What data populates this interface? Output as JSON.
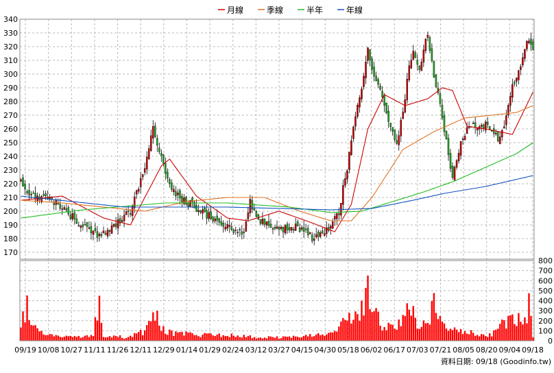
{
  "legend": [
    {
      "label": "月線",
      "color": "#cc0000"
    },
    {
      "label": "季線",
      "color": "#e07020"
    },
    {
      "label": "半年",
      "color": "#22bb22"
    },
    {
      "label": "年線",
      "color": "#1050c0"
    }
  ],
  "footer": {
    "text": "資料日期: 09/18 (Goodinfo.tw)"
  },
  "colors": {
    "up": "#d00000",
    "down": "#22aa22",
    "volume": "#ff0000",
    "grid": "#b8b8b8"
  },
  "chart_data": [
    {
      "type": "candlestick",
      "ylim": [
        165,
        340
      ],
      "yticks": [
        170,
        180,
        190,
        200,
        210,
        220,
        230,
        240,
        250,
        260,
        270,
        280,
        290,
        300,
        310,
        320,
        330,
        340
      ],
      "x_tick_labels": [
        "09/19",
        "10/08",
        "10/27",
        "11/11",
        "11/26",
        "12/11",
        "12/29",
        "01/14",
        "01/29",
        "02/24",
        "03/12",
        "03/27",
        "04/15",
        "04/30",
        "05/18",
        "06/02",
        "06/17",
        "07/03",
        "07/21",
        "08/05",
        "08/20",
        "09/04",
        "09/18"
      ],
      "close_knots": [
        [
          0,
          222
        ],
        [
          3,
          214
        ],
        [
          8,
          211
        ],
        [
          13,
          209
        ],
        [
          18,
          205
        ],
        [
          23,
          199
        ],
        [
          28,
          190
        ],
        [
          33,
          186
        ],
        [
          38,
          181
        ],
        [
          43,
          186
        ],
        [
          48,
          193
        ],
        [
          53,
          200
        ],
        [
          57,
          218
        ],
        [
          61,
          238
        ],
        [
          64,
          263
        ],
        [
          67,
          244
        ],
        [
          71,
          224
        ],
        [
          75,
          212
        ],
        [
          80,
          207
        ],
        [
          86,
          201
        ],
        [
          92,
          196
        ],
        [
          98,
          190
        ],
        [
          103,
          186
        ],
        [
          108,
          184
        ],
        [
          111,
          208
        ],
        [
          114,
          196
        ],
        [
          120,
          189
        ],
        [
          126,
          187
        ],
        [
          132,
          189
        ],
        [
          138,
          185
        ],
        [
          142,
          179
        ],
        [
          146,
          184
        ],
        [
          150,
          188
        ],
        [
          154,
          200
        ],
        [
          158,
          232
        ],
        [
          162,
          268
        ],
        [
          165,
          290
        ],
        [
          168,
          318
        ],
        [
          171,
          300
        ],
        [
          174,
          288
        ],
        [
          178,
          265
        ],
        [
          182,
          248
        ],
        [
          185,
          272
        ],
        [
          188,
          305
        ],
        [
          190,
          315
        ],
        [
          193,
          305
        ],
        [
          197,
          330
        ],
        [
          200,
          300
        ],
        [
          203,
          278
        ],
        [
          206,
          250
        ],
        [
          209,
          226
        ],
        [
          213,
          250
        ],
        [
          217,
          264
        ],
        [
          221,
          262
        ],
        [
          225,
          263
        ],
        [
          229,
          258
        ],
        [
          232,
          252
        ],
        [
          235,
          270
        ],
        [
          238,
          290
        ],
        [
          241,
          300
        ],
        [
          244,
          316
        ],
        [
          246,
          326
        ],
        [
          248,
          318
        ]
      ],
      "lines": [
        {
          "name": "月線",
          "knots": [
            [
              0,
              208
            ],
            [
              20,
              211
            ],
            [
              40,
              195
            ],
            [
              53,
              190
            ],
            [
              68,
              233
            ],
            [
              72,
              238
            ],
            [
              85,
              211
            ],
            [
              100,
              195
            ],
            [
              110,
              193
            ],
            [
              125,
              200
            ],
            [
              140,
              192
            ],
            [
              152,
              185
            ],
            [
              160,
              205
            ],
            [
              168,
              260
            ],
            [
              176,
              285
            ],
            [
              186,
              277
            ],
            [
              197,
              282
            ],
            [
              204,
              290
            ],
            [
              209,
              288
            ],
            [
              216,
              262
            ],
            [
              225,
              260
            ],
            [
              238,
              256
            ],
            [
              248,
              287
            ]
          ]
        },
        {
          "name": "季線",
          "knots": [
            [
              0,
              208
            ],
            [
              20,
              206
            ],
            [
              40,
              203
            ],
            [
              60,
              200
            ],
            [
              80,
              207
            ],
            [
              100,
              210
            ],
            [
              118,
              210
            ],
            [
              135,
              200
            ],
            [
              150,
              193
            ],
            [
              160,
              193
            ],
            [
              170,
              210
            ],
            [
              185,
              245
            ],
            [
              200,
              258
            ],
            [
              215,
              268
            ],
            [
              228,
              270
            ],
            [
              240,
              272
            ],
            [
              248,
              277
            ]
          ]
        },
        {
          "name": "半年",
          "knots": [
            [
              0,
              195
            ],
            [
              30,
              201
            ],
            [
              70,
              206
            ],
            [
              100,
              206
            ],
            [
              130,
              203
            ],
            [
              150,
              199
            ],
            [
              165,
              200
            ],
            [
              180,
              207
            ],
            [
              195,
              214
            ],
            [
              210,
              222
            ],
            [
              225,
              232
            ],
            [
              240,
              242
            ],
            [
              248,
              250
            ]
          ]
        },
        {
          "name": "年線",
          "knots": [
            [
              0,
              211
            ],
            [
              50,
              203
            ],
            [
              100,
              203
            ],
            [
              150,
              201
            ],
            [
              170,
              202
            ],
            [
              190,
              208
            ],
            [
              205,
              213
            ],
            [
              225,
              218
            ],
            [
              248,
              226
            ]
          ]
        }
      ]
    },
    {
      "type": "bar",
      "ylim": [
        0,
        800
      ],
      "yticks": [
        0,
        100,
        200,
        300,
        400,
        500,
        600,
        700,
        800
      ],
      "volume_knots": [
        [
          0,
          150
        ],
        [
          3,
          380
        ],
        [
          6,
          140
        ],
        [
          12,
          60
        ],
        [
          20,
          55
        ],
        [
          30,
          45
        ],
        [
          35,
          55
        ],
        [
          38,
          520
        ],
        [
          40,
          50
        ],
        [
          48,
          45
        ],
        [
          52,
          30
        ],
        [
          56,
          90
        ],
        [
          60,
          100
        ],
        [
          65,
          290
        ],
        [
          68,
          120
        ],
        [
          75,
          80
        ],
        [
          85,
          65
        ],
        [
          95,
          60
        ],
        [
          105,
          55
        ],
        [
          115,
          40
        ],
        [
          125,
          35
        ],
        [
          135,
          45
        ],
        [
          145,
          60
        ],
        [
          152,
          80
        ],
        [
          158,
          230
        ],
        [
          163,
          300
        ],
        [
          166,
          420
        ],
        [
          169,
          560
        ],
        [
          172,
          300
        ],
        [
          175,
          130
        ],
        [
          180,
          160
        ],
        [
          185,
          220
        ],
        [
          188,
          380
        ],
        [
          190,
          300
        ],
        [
          193,
          120
        ],
        [
          198,
          240
        ],
        [
          200,
          420
        ],
        [
          204,
          150
        ],
        [
          208,
          130
        ],
        [
          212,
          140
        ],
        [
          220,
          70
        ],
        [
          228,
          60
        ],
        [
          234,
          200
        ],
        [
          240,
          240
        ],
        [
          244,
          180
        ],
        [
          246,
          380
        ],
        [
          248,
          60
        ]
      ]
    }
  ]
}
